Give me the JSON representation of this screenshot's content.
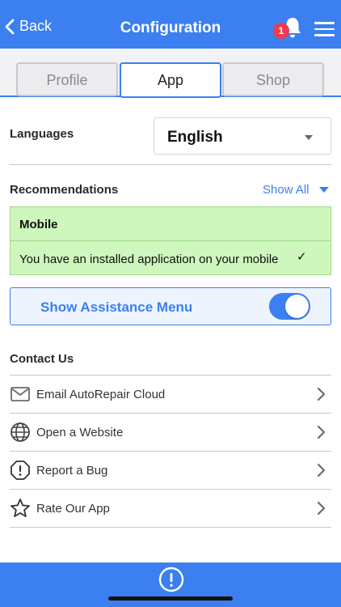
{
  "header": {
    "back_label": "Back",
    "title": "Configuration",
    "notification_count": "1",
    "notification_icon": "bell-icon",
    "menu_icon": "hamburger-menu-icon"
  },
  "tabs": [
    {
      "label": "Profile",
      "active": false
    },
    {
      "label": "App",
      "active": true
    },
    {
      "label": "Shop",
      "active": false
    }
  ],
  "languages": {
    "label": "Languages",
    "selected": "English"
  },
  "recommendations": {
    "label": "Recommendations",
    "show_all": "Show All",
    "group_title": "Mobile",
    "item_text": "You have an installed application on your mobile",
    "item_checked": true
  },
  "assistance": {
    "label": "Show Assistance Menu",
    "enabled": true
  },
  "contact": {
    "label": "Contact Us",
    "items": [
      {
        "label": "Email AutoRepair Cloud",
        "icon": "envelope-icon"
      },
      {
        "label": "Open a Website",
        "icon": "globe-icon"
      },
      {
        "label": "Report a Bug",
        "icon": "alert-octagon-icon"
      },
      {
        "label": "Rate Our App",
        "icon": "star-icon"
      }
    ]
  },
  "footer": {
    "help_icon": "alert-circle-icon"
  },
  "colors": {
    "accent": "#3b7ff0",
    "badge": "#ee3b4e",
    "recommendation_bg": "#cdf7bc"
  }
}
